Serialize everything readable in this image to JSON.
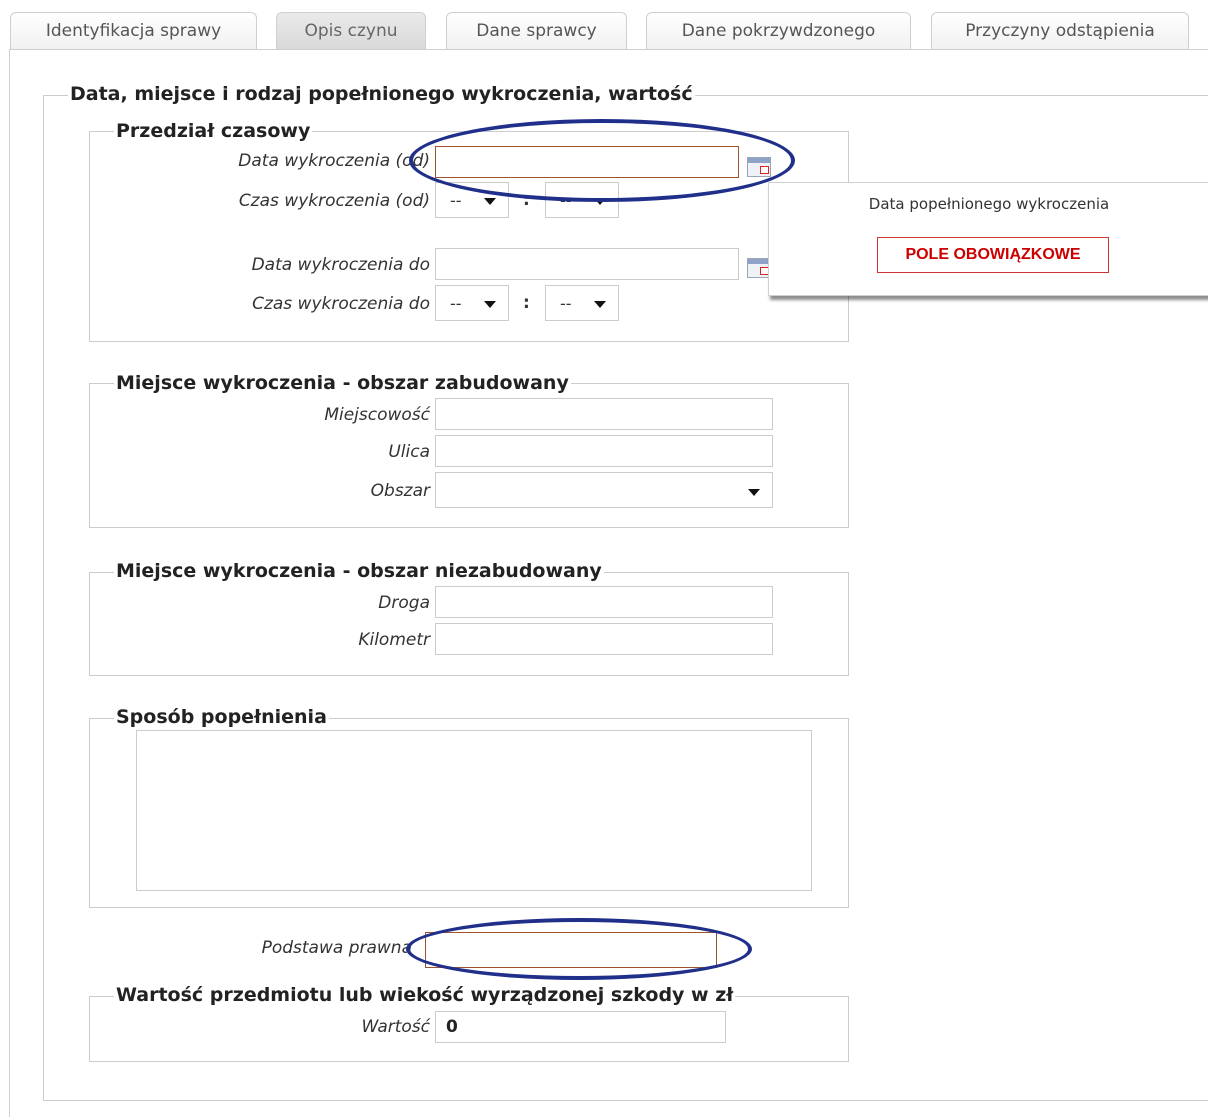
{
  "tabs": [
    {
      "label": "Identyfikacja sprawy",
      "active": false
    },
    {
      "label": "Opis czynu",
      "active": true
    },
    {
      "label": "Dane sprawcy",
      "active": false
    },
    {
      "label": "Dane pokrzywdzonego",
      "active": false
    },
    {
      "label": "Przyczyny odstąpienia",
      "active": false
    }
  ],
  "main_section": {
    "legend": "Data, miejsce i rodzaj popełnionego wykroczenia, wartość"
  },
  "time_range": {
    "legend": "Przedział czasowy",
    "date_from_label": "Data wykroczenia (od)",
    "date_from_value": "",
    "time_from_label": "Czas wykroczenia (od)",
    "time_from_hour": "--",
    "time_from_minute": "--",
    "date_to_label": "Data wykroczenia do",
    "date_to_value": "",
    "time_to_label": "Czas wykroczenia do",
    "time_to_hour": "--",
    "time_to_minute": "--",
    "colon": ":"
  },
  "tooltip": {
    "title": "Data popełnionego wykroczenia",
    "required": "POLE OBOWIĄZKOWE"
  },
  "built_up": {
    "legend": "Miejsce wykroczenia - obszar zabudowany",
    "city_label": "Miejscowość",
    "street_label": "Ulica",
    "area_label": "Obszar",
    "city_value": "",
    "street_value": "",
    "area_value": ""
  },
  "non_built_up": {
    "legend": "Miejsce wykroczenia - obszar niezabudowany",
    "road_label": "Droga",
    "km_label": "Kilometr",
    "road_value": "",
    "km_value": ""
  },
  "method": {
    "legend": "Sposób popełnienia",
    "value": ""
  },
  "legal_basis": {
    "label": "Podstawa prawna",
    "value": ""
  },
  "value_section": {
    "legend": "Wartość przedmiotu lub wiekość wyrządzonej szkody w zł",
    "label": "Wartość",
    "value": "0"
  },
  "colors": {
    "annotation_ellipse": "#1f2f8a",
    "required_border": "#a0522d",
    "required_text": "#cc0000"
  }
}
